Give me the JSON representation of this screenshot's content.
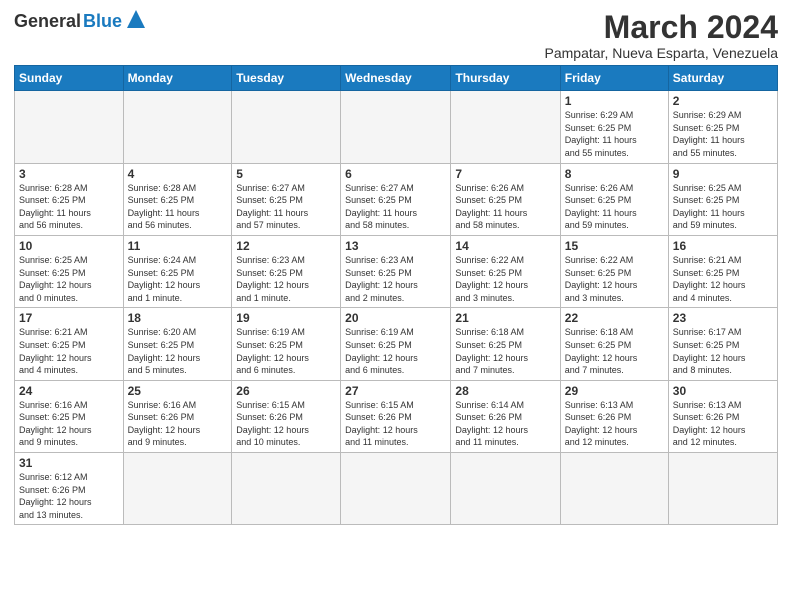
{
  "logo": {
    "text1": "General",
    "text2": "Blue"
  },
  "header": {
    "title": "March 2024",
    "location": "Pampatar, Nueva Esparta, Venezuela"
  },
  "weekdays": [
    "Sunday",
    "Monday",
    "Tuesday",
    "Wednesday",
    "Thursday",
    "Friday",
    "Saturday"
  ],
  "weeks": [
    [
      {
        "day": "",
        "info": ""
      },
      {
        "day": "",
        "info": ""
      },
      {
        "day": "",
        "info": ""
      },
      {
        "day": "",
        "info": ""
      },
      {
        "day": "",
        "info": ""
      },
      {
        "day": "1",
        "info": "Sunrise: 6:29 AM\nSunset: 6:25 PM\nDaylight: 11 hours\nand 55 minutes."
      },
      {
        "day": "2",
        "info": "Sunrise: 6:29 AM\nSunset: 6:25 PM\nDaylight: 11 hours\nand 55 minutes."
      }
    ],
    [
      {
        "day": "3",
        "info": "Sunrise: 6:28 AM\nSunset: 6:25 PM\nDaylight: 11 hours\nand 56 minutes."
      },
      {
        "day": "4",
        "info": "Sunrise: 6:28 AM\nSunset: 6:25 PM\nDaylight: 11 hours\nand 56 minutes."
      },
      {
        "day": "5",
        "info": "Sunrise: 6:27 AM\nSunset: 6:25 PM\nDaylight: 11 hours\nand 57 minutes."
      },
      {
        "day": "6",
        "info": "Sunrise: 6:27 AM\nSunset: 6:25 PM\nDaylight: 11 hours\nand 58 minutes."
      },
      {
        "day": "7",
        "info": "Sunrise: 6:26 AM\nSunset: 6:25 PM\nDaylight: 11 hours\nand 58 minutes."
      },
      {
        "day": "8",
        "info": "Sunrise: 6:26 AM\nSunset: 6:25 PM\nDaylight: 11 hours\nand 59 minutes."
      },
      {
        "day": "9",
        "info": "Sunrise: 6:25 AM\nSunset: 6:25 PM\nDaylight: 11 hours\nand 59 minutes."
      }
    ],
    [
      {
        "day": "10",
        "info": "Sunrise: 6:25 AM\nSunset: 6:25 PM\nDaylight: 12 hours\nand 0 minutes."
      },
      {
        "day": "11",
        "info": "Sunrise: 6:24 AM\nSunset: 6:25 PM\nDaylight: 12 hours\nand 1 minute."
      },
      {
        "day": "12",
        "info": "Sunrise: 6:23 AM\nSunset: 6:25 PM\nDaylight: 12 hours\nand 1 minute."
      },
      {
        "day": "13",
        "info": "Sunrise: 6:23 AM\nSunset: 6:25 PM\nDaylight: 12 hours\nand 2 minutes."
      },
      {
        "day": "14",
        "info": "Sunrise: 6:22 AM\nSunset: 6:25 PM\nDaylight: 12 hours\nand 3 minutes."
      },
      {
        "day": "15",
        "info": "Sunrise: 6:22 AM\nSunset: 6:25 PM\nDaylight: 12 hours\nand 3 minutes."
      },
      {
        "day": "16",
        "info": "Sunrise: 6:21 AM\nSunset: 6:25 PM\nDaylight: 12 hours\nand 4 minutes."
      }
    ],
    [
      {
        "day": "17",
        "info": "Sunrise: 6:21 AM\nSunset: 6:25 PM\nDaylight: 12 hours\nand 4 minutes."
      },
      {
        "day": "18",
        "info": "Sunrise: 6:20 AM\nSunset: 6:25 PM\nDaylight: 12 hours\nand 5 minutes."
      },
      {
        "day": "19",
        "info": "Sunrise: 6:19 AM\nSunset: 6:25 PM\nDaylight: 12 hours\nand 6 minutes."
      },
      {
        "day": "20",
        "info": "Sunrise: 6:19 AM\nSunset: 6:25 PM\nDaylight: 12 hours\nand 6 minutes."
      },
      {
        "day": "21",
        "info": "Sunrise: 6:18 AM\nSunset: 6:25 PM\nDaylight: 12 hours\nand 7 minutes."
      },
      {
        "day": "22",
        "info": "Sunrise: 6:18 AM\nSunset: 6:25 PM\nDaylight: 12 hours\nand 7 minutes."
      },
      {
        "day": "23",
        "info": "Sunrise: 6:17 AM\nSunset: 6:25 PM\nDaylight: 12 hours\nand 8 minutes."
      }
    ],
    [
      {
        "day": "24",
        "info": "Sunrise: 6:16 AM\nSunset: 6:25 PM\nDaylight: 12 hours\nand 9 minutes."
      },
      {
        "day": "25",
        "info": "Sunrise: 6:16 AM\nSunset: 6:26 PM\nDaylight: 12 hours\nand 9 minutes."
      },
      {
        "day": "26",
        "info": "Sunrise: 6:15 AM\nSunset: 6:26 PM\nDaylight: 12 hours\nand 10 minutes."
      },
      {
        "day": "27",
        "info": "Sunrise: 6:15 AM\nSunset: 6:26 PM\nDaylight: 12 hours\nand 11 minutes."
      },
      {
        "day": "28",
        "info": "Sunrise: 6:14 AM\nSunset: 6:26 PM\nDaylight: 12 hours\nand 11 minutes."
      },
      {
        "day": "29",
        "info": "Sunrise: 6:13 AM\nSunset: 6:26 PM\nDaylight: 12 hours\nand 12 minutes."
      },
      {
        "day": "30",
        "info": "Sunrise: 6:13 AM\nSunset: 6:26 PM\nDaylight: 12 hours\nand 12 minutes."
      }
    ],
    [
      {
        "day": "31",
        "info": "Sunrise: 6:12 AM\nSunset: 6:26 PM\nDaylight: 12 hours\nand 13 minutes."
      },
      {
        "day": "",
        "info": ""
      },
      {
        "day": "",
        "info": ""
      },
      {
        "day": "",
        "info": ""
      },
      {
        "day": "",
        "info": ""
      },
      {
        "day": "",
        "info": ""
      },
      {
        "day": "",
        "info": ""
      }
    ]
  ]
}
